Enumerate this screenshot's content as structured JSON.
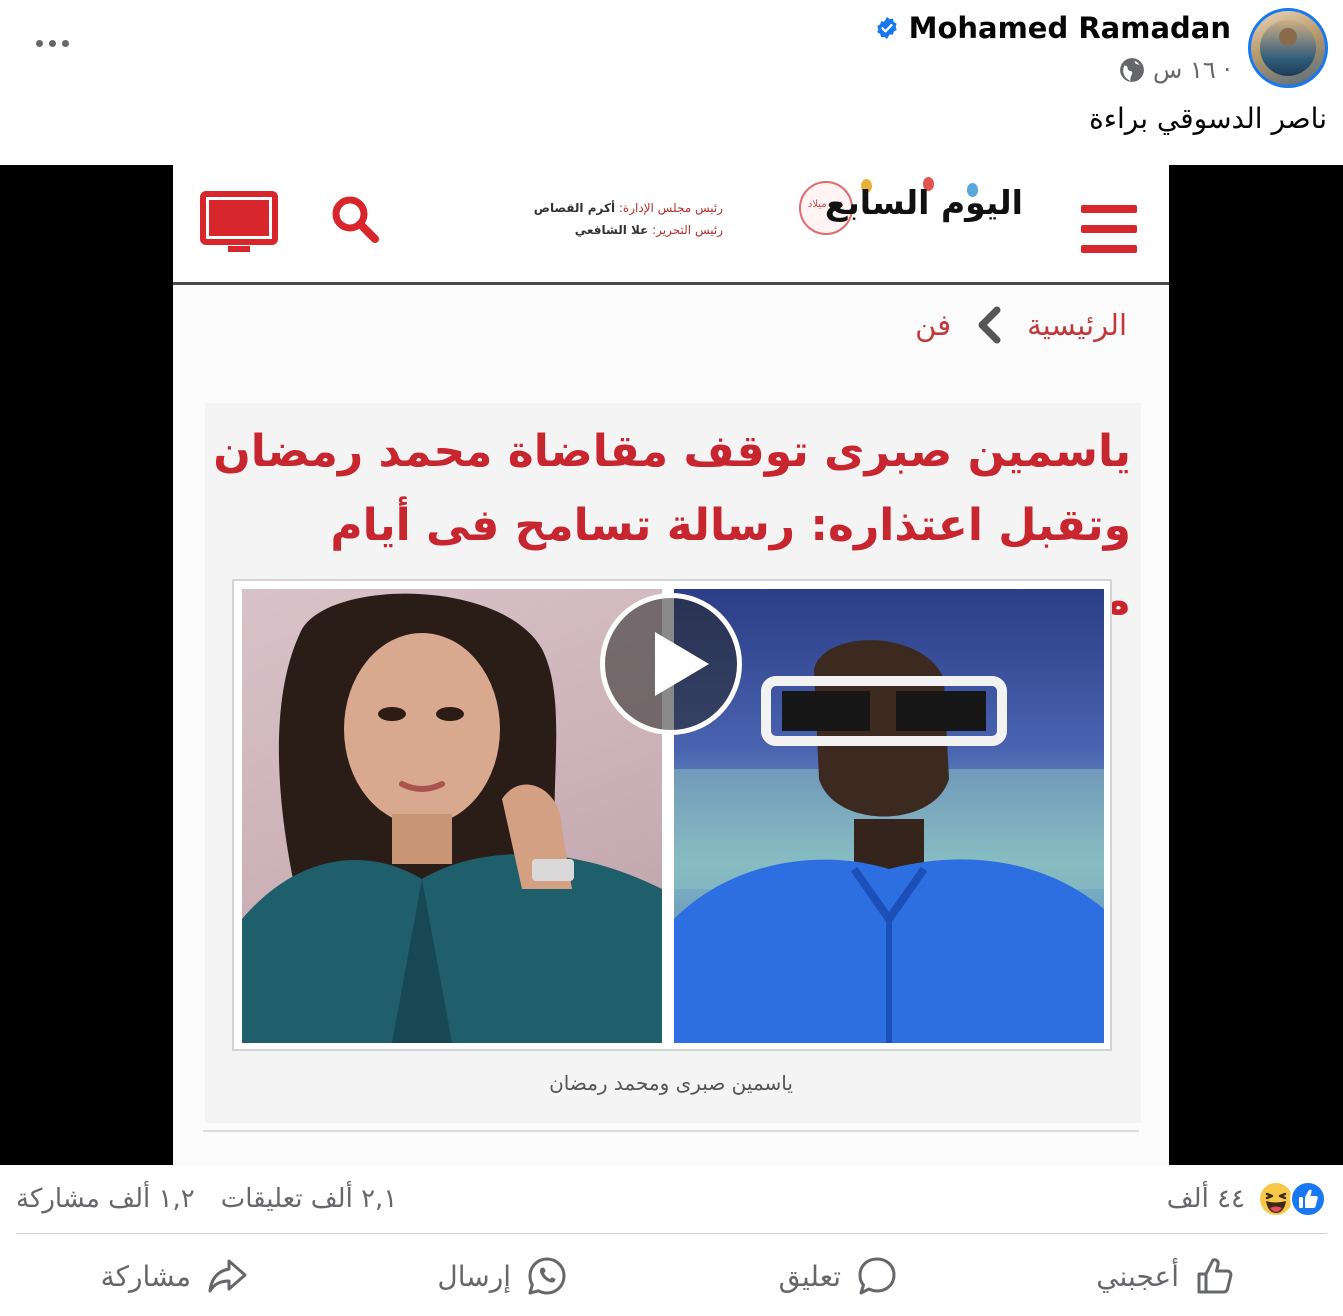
{
  "post": {
    "author": "Mohamed Ramadan",
    "timestamp": "١٦ س ·",
    "caption": "ناصر الدسوقي براءة"
  },
  "video": {
    "site_logo": "اليوم السابع",
    "site_seal": "عيد ميلاد",
    "editors_line1_label": "رئيس مجلس الإدارة:",
    "editors_line1_name": "أكرم القصاص",
    "editors_line2_label": "رئيس التحرير:",
    "editors_line2_name": "علا الشافعي",
    "breadcrumb_home": "الرئيسية",
    "breadcrumb_section": "فن",
    "headline": "ياسمين صبرى توقف مقاضاة محمد رمضان وتقبل اعتذاره: رسالة تسامح فى أيام مفترجة",
    "photo_caption": "ياسمين صبرى ومحمد رمضان"
  },
  "stats": {
    "reactions_count": "٤٤ ألف",
    "comments_count": "٢,١ ألف تعليقات",
    "shares_count": "١,٢ ألف مشاركة"
  },
  "actions": {
    "like": "أعجبني",
    "comment": "تعليق",
    "send": "إرسال",
    "share": "مشاركة"
  },
  "colors": {
    "facebook_blue": "#1877f2",
    "headline_red": "#c8262e",
    "secondary_text": "#65676b"
  }
}
